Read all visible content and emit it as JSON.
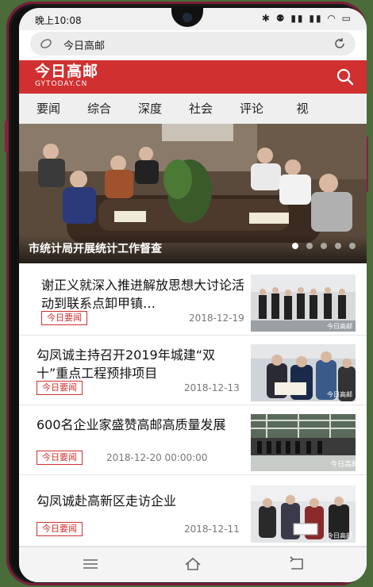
{
  "status": {
    "time": "晚上10:08",
    "icons": "✱ ⚉ ▮▮ ▮▮ ◠ ▭"
  },
  "browser": {
    "url_text": "今日高邮"
  },
  "header": {
    "logo_cn": "今日高邮",
    "logo_en": "GYTODAY.CN"
  },
  "tabs": [
    "要闻",
    "综合",
    "深度",
    "社会",
    "评论",
    "视"
  ],
  "hero": {
    "caption": "市统计局开展统计工作督查",
    "slide_count": 5,
    "active_slide": 1
  },
  "news": [
    {
      "title": "谢正义就深入推进解放思想大讨论活动到联系点卸甲镇…",
      "badge": "今日要闻",
      "date": "2018-12-19"
    },
    {
      "title": "勾凤诚主持召开2019年城建“双十”重点工程预排项目",
      "badge": "今日要闻",
      "date": "2018-12-13"
    },
    {
      "title": "600名企业家盛赞高邮高质量发展",
      "badge": "今日要闻",
      "date": "2018-12-20 00:00:00"
    },
    {
      "title": "勾凤诚赴高新区走访企业",
      "badge": "今日要闻",
      "date": "2018-12-11"
    }
  ],
  "thumb_watermark": "今日高邮",
  "colors": {
    "brand": "#d0302f"
  },
  "icons": {
    "url_left": "shield-icon",
    "url_right": "refresh-icon",
    "header_right": "search-icon",
    "nav_menu": "menu-icon",
    "nav_home": "home-icon",
    "nav_back": "back-icon"
  }
}
